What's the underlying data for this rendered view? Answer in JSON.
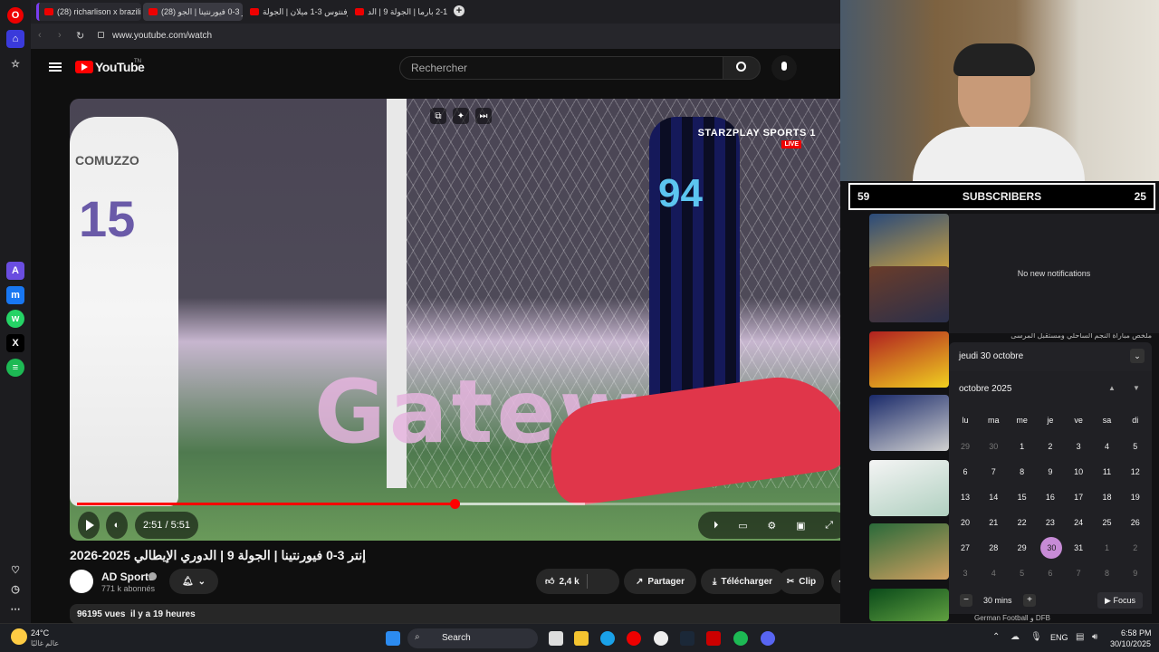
{
  "browser": {
    "tabs": [
      {
        "label": "(28) richarlison x brazilian"
      },
      {
        "label": "إنتر 3-0 فيورنتينا | الجو (28)"
      },
      {
        "label": "يوفنتوس 3-1 ميلان | الجولة"
      },
      {
        "label": "روما 1-2 بارما | الجولة 9 | الد"
      }
    ],
    "new_tab": "+",
    "url": "www.youtube.com/watch"
  },
  "youtube": {
    "logo": "YouTube",
    "logo_suffix": "TN",
    "search_placeholder": "Rechercher",
    "video": {
      "channel_logo_text": "STARZPLAY SPORTS 1",
      "live": "LIVE",
      "stadium_text": "Gatewa",
      "player1_number": "15",
      "player1_name": "COMUZZO",
      "player2_number": "94",
      "time": "2:51 / 5:51",
      "progress": 0.49,
      "buffered": 0.66
    },
    "title": "إنتر 3-0 فيورنتينا | الجولة 9 | الدوري الإيطالي 2025-2026",
    "channel": {
      "name": "AD Sports",
      "subs": "771 k abonnés"
    },
    "actions": {
      "likes": "2,4 k",
      "share": "Partager",
      "download": "Télécharger",
      "clip": "Clip"
    },
    "description": {
      "views": "96195 vues",
      "date": "il y a 19 heures"
    }
  },
  "stream": {
    "subs_left": "59",
    "subs_label": "SUBSCRIBERS",
    "subs_right": "25",
    "notification_text": "No new notifications",
    "thumb_captions": [
      "ملخص مباراة النجم الساحلي ومستقبل المرسى",
      "German Football و DFB"
    ]
  },
  "calendar": {
    "header_date": "jeudi 30 octobre",
    "month": "octobre 2025",
    "weekdays": [
      "lu",
      "ma",
      "me",
      "je",
      "ve",
      "sa",
      "di"
    ],
    "weeks": [
      [
        "29",
        "30",
        "1",
        "2",
        "3",
        "4",
        "5"
      ],
      [
        "6",
        "7",
        "8",
        "9",
        "10",
        "11",
        "12"
      ],
      [
        "13",
        "14",
        "15",
        "16",
        "17",
        "18",
        "19"
      ],
      [
        "20",
        "21",
        "22",
        "23",
        "24",
        "25",
        "26"
      ],
      [
        "27",
        "28",
        "29",
        "30",
        "31",
        "1",
        "2"
      ],
      [
        "3",
        "4",
        "5",
        "6",
        "7",
        "8",
        "9"
      ]
    ],
    "today": "30",
    "focus_minutes": "30 mins",
    "focus_label": "Focus"
  },
  "taskbar": {
    "weather_temp": "24°C",
    "weather_place": "عالم غالبًا",
    "search": "Search",
    "lang": "ENG",
    "time": "6:58 PM",
    "date": "30/10/2025"
  },
  "colors": {
    "yt_red": "#ff0000",
    "accent_pink": "#c78bd6",
    "bg": "#0f0f0f"
  }
}
